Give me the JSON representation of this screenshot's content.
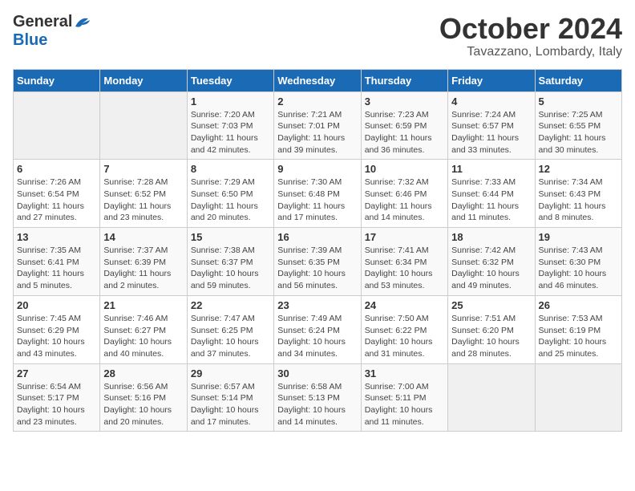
{
  "header": {
    "logo_general": "General",
    "logo_blue": "Blue",
    "month_title": "October 2024",
    "location": "Tavazzano, Lombardy, Italy"
  },
  "calendar": {
    "days_of_week": [
      "Sunday",
      "Monday",
      "Tuesday",
      "Wednesday",
      "Thursday",
      "Friday",
      "Saturday"
    ],
    "weeks": [
      [
        {
          "day": "",
          "info": ""
        },
        {
          "day": "",
          "info": ""
        },
        {
          "day": "1",
          "info": "Sunrise: 7:20 AM\nSunset: 7:03 PM\nDaylight: 11 hours and 42 minutes."
        },
        {
          "day": "2",
          "info": "Sunrise: 7:21 AM\nSunset: 7:01 PM\nDaylight: 11 hours and 39 minutes."
        },
        {
          "day": "3",
          "info": "Sunrise: 7:23 AM\nSunset: 6:59 PM\nDaylight: 11 hours and 36 minutes."
        },
        {
          "day": "4",
          "info": "Sunrise: 7:24 AM\nSunset: 6:57 PM\nDaylight: 11 hours and 33 minutes."
        },
        {
          "day": "5",
          "info": "Sunrise: 7:25 AM\nSunset: 6:55 PM\nDaylight: 11 hours and 30 minutes."
        }
      ],
      [
        {
          "day": "6",
          "info": "Sunrise: 7:26 AM\nSunset: 6:54 PM\nDaylight: 11 hours and 27 minutes."
        },
        {
          "day": "7",
          "info": "Sunrise: 7:28 AM\nSunset: 6:52 PM\nDaylight: 11 hours and 23 minutes."
        },
        {
          "day": "8",
          "info": "Sunrise: 7:29 AM\nSunset: 6:50 PM\nDaylight: 11 hours and 20 minutes."
        },
        {
          "day": "9",
          "info": "Sunrise: 7:30 AM\nSunset: 6:48 PM\nDaylight: 11 hours and 17 minutes."
        },
        {
          "day": "10",
          "info": "Sunrise: 7:32 AM\nSunset: 6:46 PM\nDaylight: 11 hours and 14 minutes."
        },
        {
          "day": "11",
          "info": "Sunrise: 7:33 AM\nSunset: 6:44 PM\nDaylight: 11 hours and 11 minutes."
        },
        {
          "day": "12",
          "info": "Sunrise: 7:34 AM\nSunset: 6:43 PM\nDaylight: 11 hours and 8 minutes."
        }
      ],
      [
        {
          "day": "13",
          "info": "Sunrise: 7:35 AM\nSunset: 6:41 PM\nDaylight: 11 hours and 5 minutes."
        },
        {
          "day": "14",
          "info": "Sunrise: 7:37 AM\nSunset: 6:39 PM\nDaylight: 11 hours and 2 minutes."
        },
        {
          "day": "15",
          "info": "Sunrise: 7:38 AM\nSunset: 6:37 PM\nDaylight: 10 hours and 59 minutes."
        },
        {
          "day": "16",
          "info": "Sunrise: 7:39 AM\nSunset: 6:35 PM\nDaylight: 10 hours and 56 minutes."
        },
        {
          "day": "17",
          "info": "Sunrise: 7:41 AM\nSunset: 6:34 PM\nDaylight: 10 hours and 53 minutes."
        },
        {
          "day": "18",
          "info": "Sunrise: 7:42 AM\nSunset: 6:32 PM\nDaylight: 10 hours and 49 minutes."
        },
        {
          "day": "19",
          "info": "Sunrise: 7:43 AM\nSunset: 6:30 PM\nDaylight: 10 hours and 46 minutes."
        }
      ],
      [
        {
          "day": "20",
          "info": "Sunrise: 7:45 AM\nSunset: 6:29 PM\nDaylight: 10 hours and 43 minutes."
        },
        {
          "day": "21",
          "info": "Sunrise: 7:46 AM\nSunset: 6:27 PM\nDaylight: 10 hours and 40 minutes."
        },
        {
          "day": "22",
          "info": "Sunrise: 7:47 AM\nSunset: 6:25 PM\nDaylight: 10 hours and 37 minutes."
        },
        {
          "day": "23",
          "info": "Sunrise: 7:49 AM\nSunset: 6:24 PM\nDaylight: 10 hours and 34 minutes."
        },
        {
          "day": "24",
          "info": "Sunrise: 7:50 AM\nSunset: 6:22 PM\nDaylight: 10 hours and 31 minutes."
        },
        {
          "day": "25",
          "info": "Sunrise: 7:51 AM\nSunset: 6:20 PM\nDaylight: 10 hours and 28 minutes."
        },
        {
          "day": "26",
          "info": "Sunrise: 7:53 AM\nSunset: 6:19 PM\nDaylight: 10 hours and 25 minutes."
        }
      ],
      [
        {
          "day": "27",
          "info": "Sunrise: 6:54 AM\nSunset: 5:17 PM\nDaylight: 10 hours and 23 minutes."
        },
        {
          "day": "28",
          "info": "Sunrise: 6:56 AM\nSunset: 5:16 PM\nDaylight: 10 hours and 20 minutes."
        },
        {
          "day": "29",
          "info": "Sunrise: 6:57 AM\nSunset: 5:14 PM\nDaylight: 10 hours and 17 minutes."
        },
        {
          "day": "30",
          "info": "Sunrise: 6:58 AM\nSunset: 5:13 PM\nDaylight: 10 hours and 14 minutes."
        },
        {
          "day": "31",
          "info": "Sunrise: 7:00 AM\nSunset: 5:11 PM\nDaylight: 10 hours and 11 minutes."
        },
        {
          "day": "",
          "info": ""
        },
        {
          "day": "",
          "info": ""
        }
      ]
    ]
  }
}
